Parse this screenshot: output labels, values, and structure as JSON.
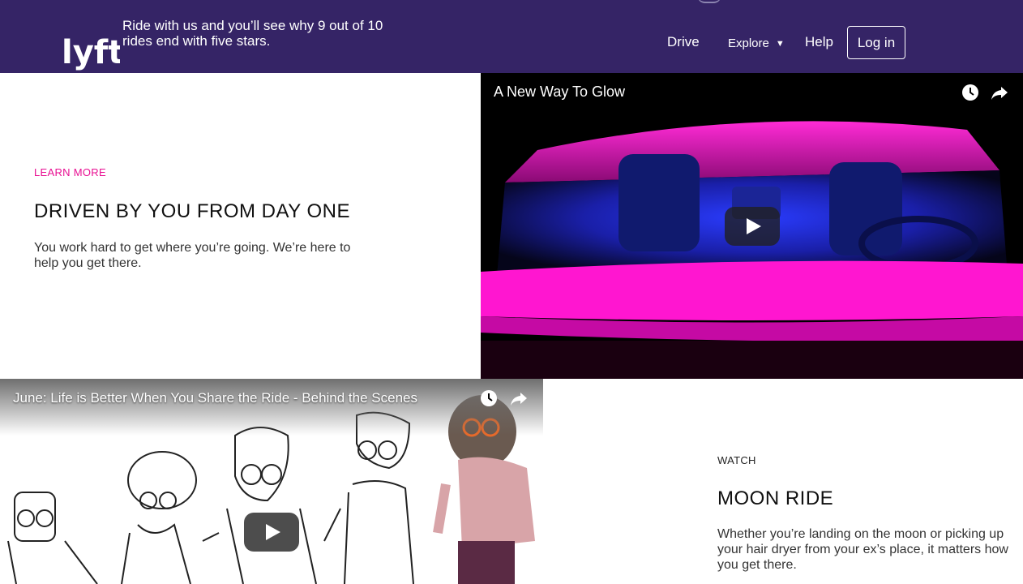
{
  "header": {
    "logo_text": "lyft",
    "tagline": "Ride with us and you’ll see why 9 out of 10 rides end with five stars.",
    "nav": {
      "drive": "Drive",
      "explore": "Explore",
      "explore_caret": "▼",
      "help": "Help",
      "login": "Log in"
    }
  },
  "section1": {
    "eyebrow": "LEARN MORE",
    "headline": "DRIVEN BY YOU FROM DAY ONE",
    "body": "You work hard to get where you’re going. We’re here to help you get there."
  },
  "video1": {
    "title": "A New Way To Glow"
  },
  "video2": {
    "title": "June: Life is Better When You Share the Ride - Behind the Scenes"
  },
  "section2": {
    "eyebrow": "WATCH",
    "headline": "MOON RIDE",
    "body": "Whether you’re landing on the moon or picking up your hair dryer from your ex’s place, it matters how you get there."
  },
  "colors": {
    "header_bg": "#352466",
    "accent_pink": "#e80f92"
  },
  "icons": [
    "watch-later-icon",
    "share-icon",
    "play-icon",
    "dropdown-caret-icon"
  ]
}
